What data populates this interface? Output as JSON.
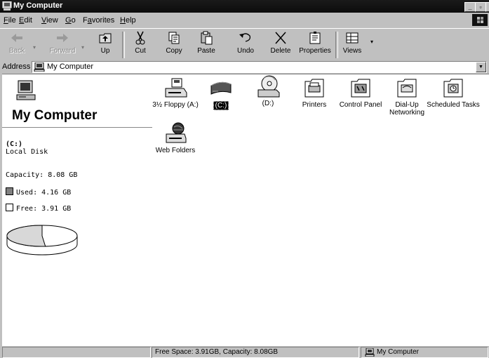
{
  "window": {
    "title": "My Computer"
  },
  "menu": [
    "File",
    "Edit",
    "View",
    "Go",
    "Favorites",
    "Help"
  ],
  "menu_underline": [
    "F",
    "E",
    "V",
    "G",
    "a",
    "H"
  ],
  "toolbar": {
    "back": "Back",
    "forward": "Forward",
    "up": "Up",
    "cut": "Cut",
    "copy": "Copy",
    "paste": "Paste",
    "undo": "Undo",
    "delete": "Delete",
    "properties": "Properties",
    "views": "Views"
  },
  "address": {
    "label": "Address",
    "value": "My Computer"
  },
  "panel": {
    "title": "My Computer",
    "drive": "(C:)",
    "drive_type": "Local Disk",
    "capacity": "Capacity: 8.08 GB",
    "used": "Used: 4.16 GB",
    "free": "Free: 3.91 GB",
    "used_fraction": 0.515,
    "used_color": "#808080",
    "free_color": "#ffffff"
  },
  "items": [
    {
      "label": "3½ Floppy (A:)",
      "icon": "floppy-drive-icon"
    },
    {
      "label": "(C:)",
      "icon": "hard-disk-icon",
      "selected": true
    },
    {
      "label": "(D:)",
      "icon": "cd-drive-icon"
    },
    {
      "label": "Printers",
      "icon": "printers-folder-icon"
    },
    {
      "label": "Control Panel",
      "icon": "control-panel-icon"
    },
    {
      "label": "Dial-Up Networking",
      "icon": "dialup-networking-icon"
    },
    {
      "label": "Scheduled Tasks",
      "icon": "scheduled-tasks-icon"
    },
    {
      "label": "Web Folders",
      "icon": "web-folders-icon"
    }
  ],
  "status": {
    "info": "Free Space: 3.91GB,  Capacity: 8.08GB",
    "zone": "My Computer"
  }
}
